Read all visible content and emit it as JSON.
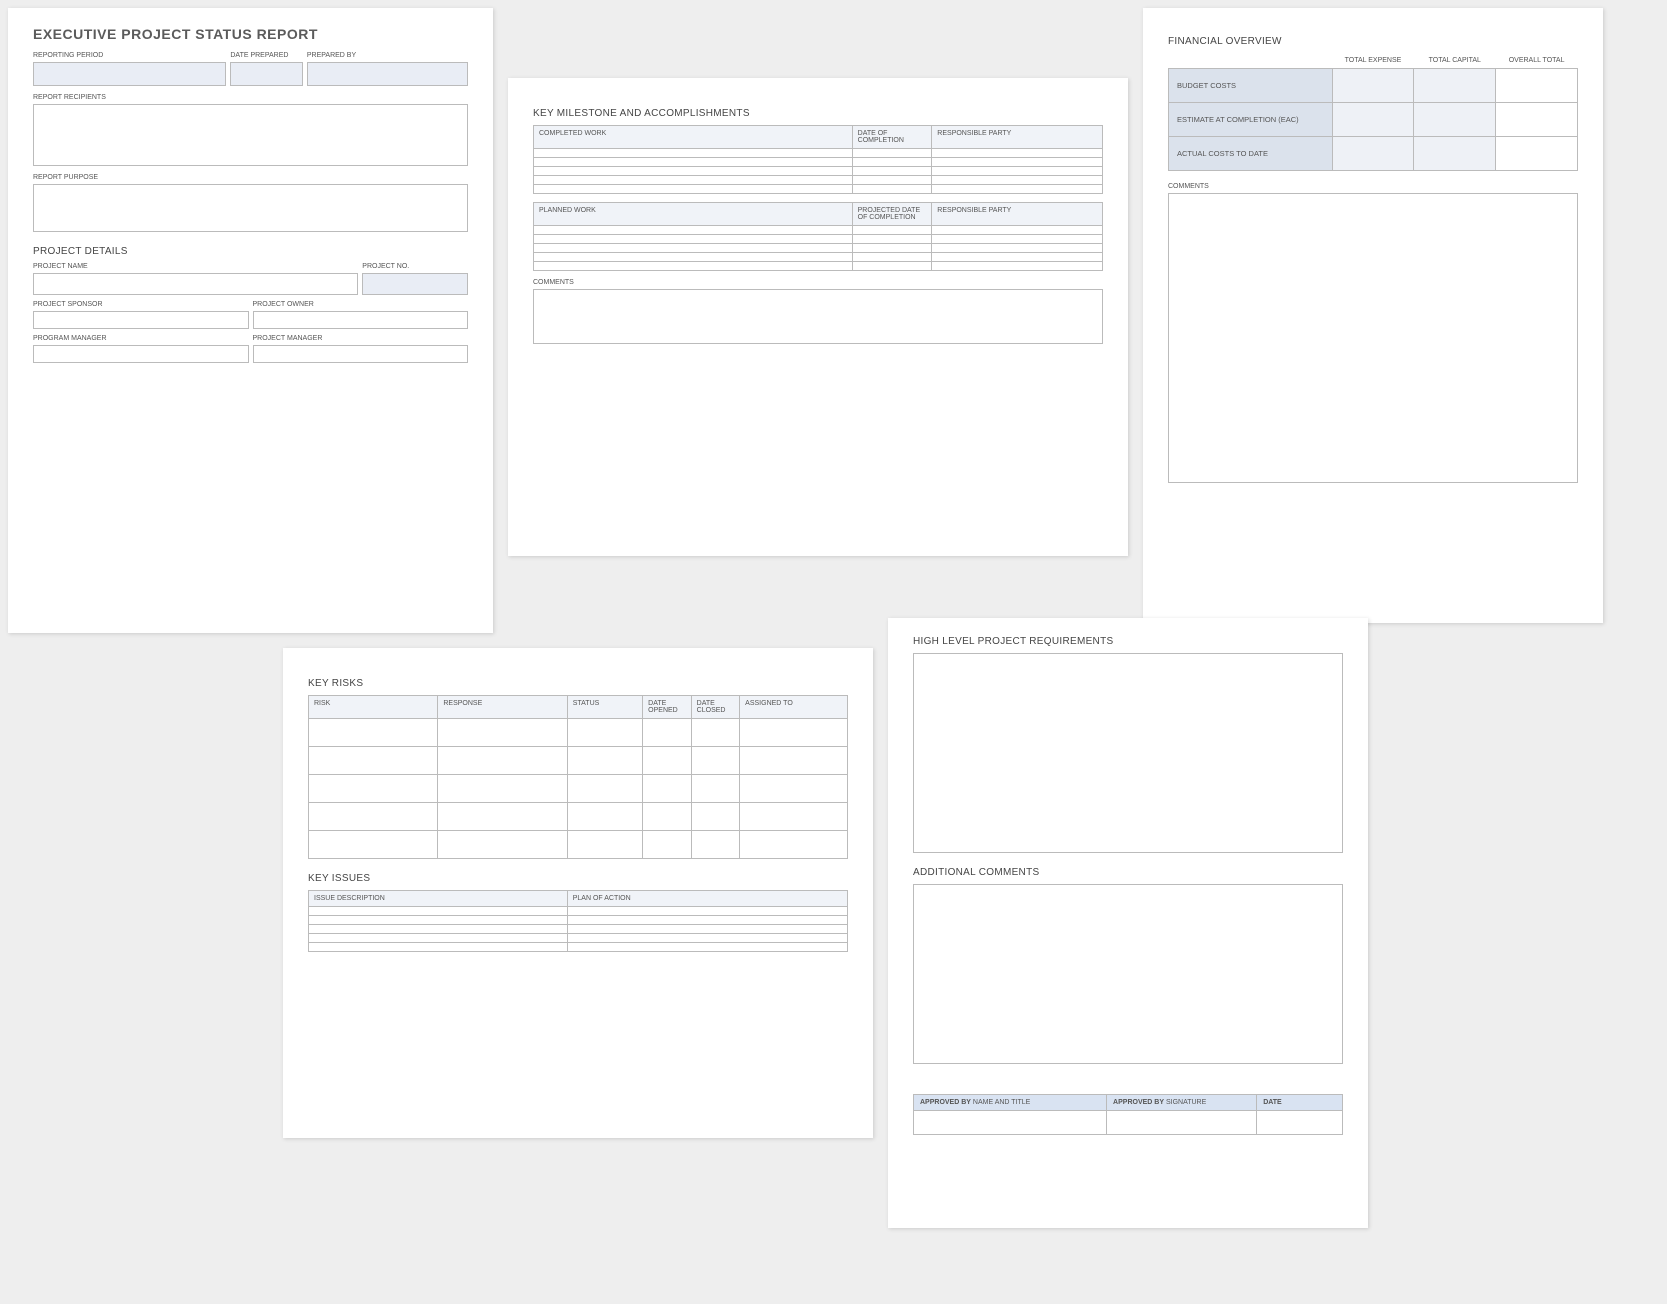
{
  "doc_title": "EXECUTIVE PROJECT STATUS REPORT",
  "header_fields": {
    "reporting_period": "REPORTING PERIOD",
    "date_prepared": "DATE PREPARED",
    "prepared_by": "PREPARED BY",
    "report_recipients": "REPORT RECIPIENTS",
    "report_purpose": "REPORT PURPOSE"
  },
  "project_details": {
    "title": "PROJECT DETAILS",
    "project_name": "PROJECT NAME",
    "project_no": "PROJECT NO.",
    "project_sponsor": "PROJECT SPONSOR",
    "project_owner": "PROJECT OWNER",
    "program_manager": "PROGRAM MANAGER",
    "project_manager": "PROJECT MANAGER"
  },
  "milestones": {
    "title": "KEY MILESTONE AND ACCOMPLISHMENTS",
    "completed_work": "COMPLETED WORK",
    "date_of_completion": "DATE OF COMPLETION",
    "responsible_party": "RESPONSIBLE PARTY",
    "planned_work": "PLANNED WORK",
    "projected_date_of_completion": "PROJECTED DATE OF COMPLETION",
    "comments": "COMMENTS"
  },
  "financial": {
    "title": "FINANCIAL OVERVIEW",
    "total_expense": "TOTAL EXPENSE",
    "total_capital": "TOTAL CAPITAL",
    "overall_total": "OVERALL TOTAL",
    "budget_costs": "BUDGET COSTS",
    "eac": "ESTIMATE AT COMPLETION (EAC)",
    "actual_costs": "ACTUAL COSTS TO DATE",
    "comments": "COMMENTS"
  },
  "risks": {
    "title": "KEY RISKS",
    "risk": "RISK",
    "response": "RESPONSE",
    "status": "STATUS",
    "date_opened": "DATE OPENED",
    "date_closed": "DATE CLOSED",
    "assigned_to": "ASSIGNED TO"
  },
  "issues": {
    "title": "KEY ISSUES",
    "issue_description": "ISSUE DESCRIPTION",
    "plan_of_action": "PLAN OF ACTION"
  },
  "requirements": {
    "title": "HIGH LEVEL PROJECT REQUIREMENTS",
    "additional_comments": "ADDITIONAL COMMENTS"
  },
  "approval": {
    "approved_by": "APPROVED BY",
    "name_and_title": " NAME AND TITLE",
    "signature": " SIGNATURE",
    "date": "DATE"
  }
}
